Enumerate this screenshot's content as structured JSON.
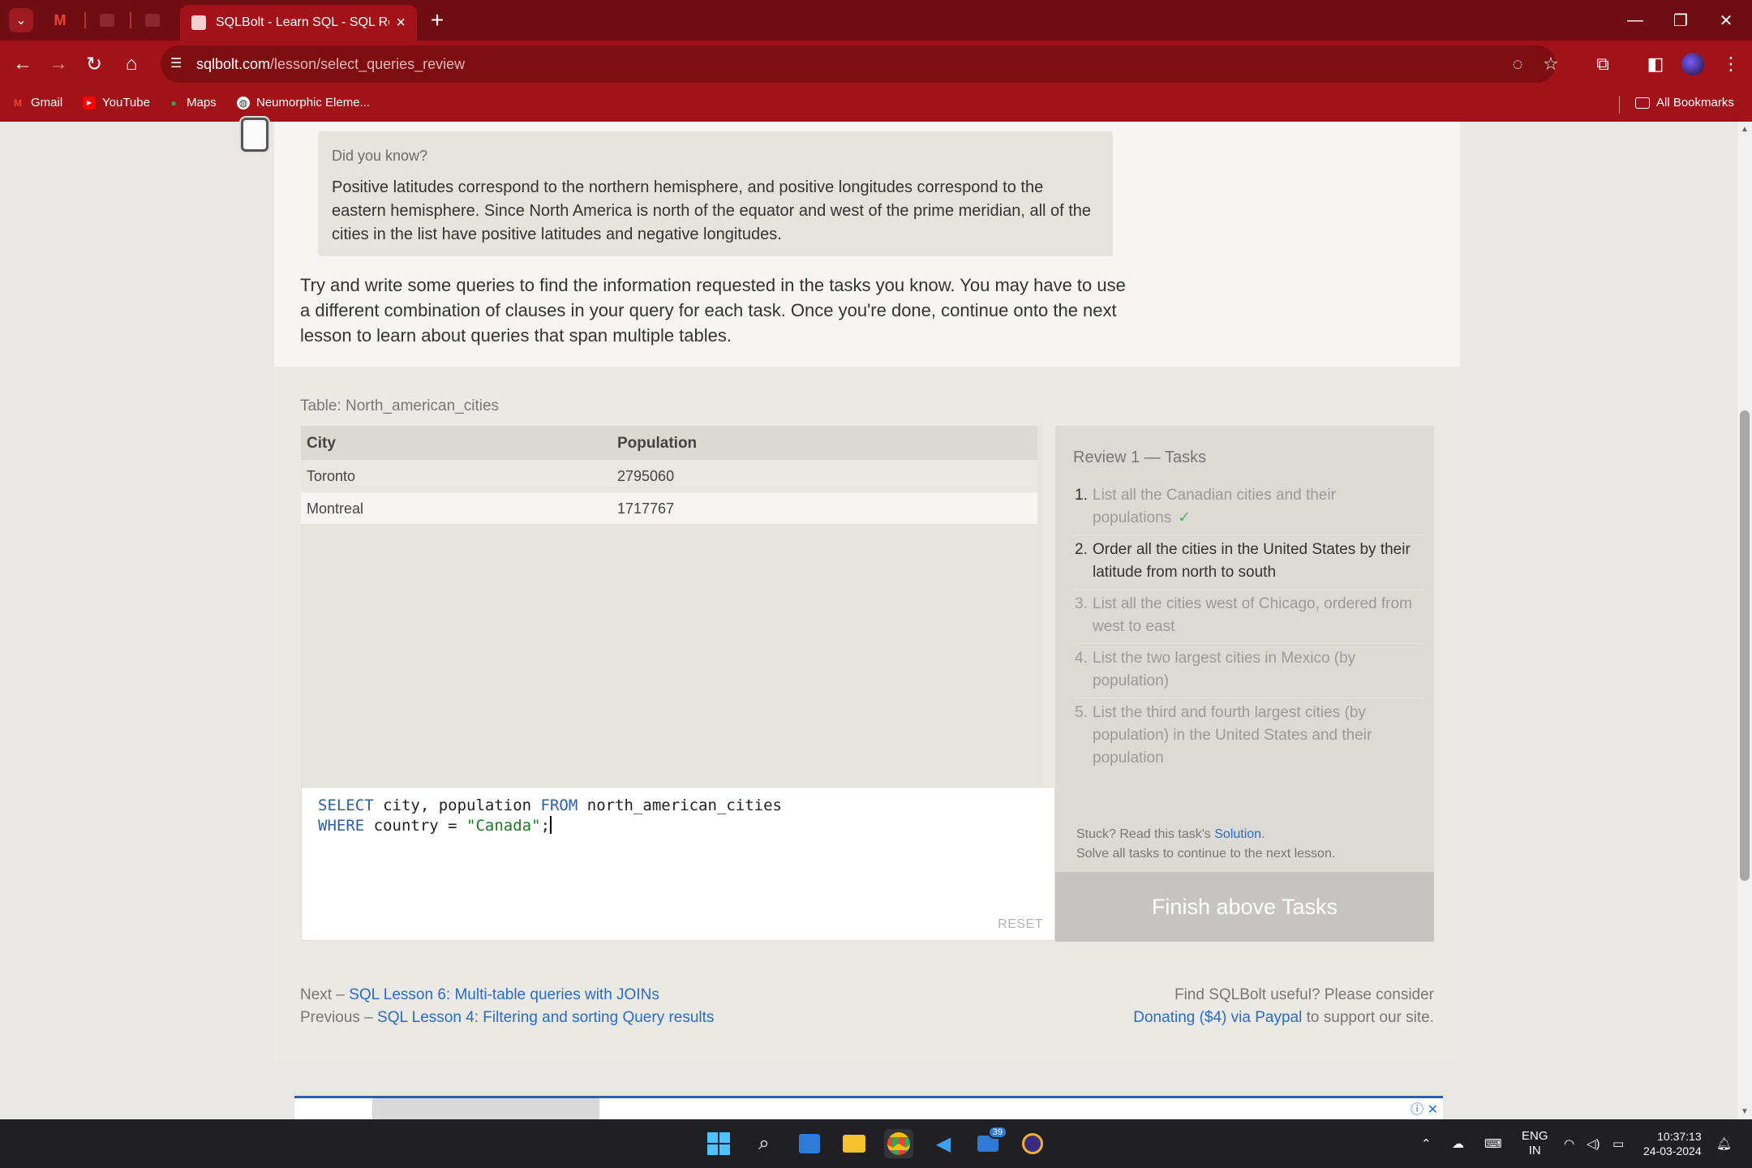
{
  "browser": {
    "active_tab_title": "SQLBolt - Learn SQL - SQL Revie",
    "url_host": "sqlbolt.com",
    "url_path": "/lesson/select_queries_review",
    "bookmarks": [
      {
        "label": "Gmail"
      },
      {
        "label": "YouTube"
      },
      {
        "label": "Maps"
      },
      {
        "label": "Neumorphic Eleme..."
      }
    ],
    "all_bookmarks": "All Bookmarks"
  },
  "lesson": {
    "did_you_know_heading": "Did you know?",
    "did_you_know_body": "Positive latitudes correspond to the northern hemisphere, and positive longitudes correspond to the eastern hemisphere. Since North America is north of the equator and west of the prime meridian, all of the cities in the list have positive latitudes and negative longitudes.",
    "intro": "Try and write some queries to find the information requested in the tasks you know. You may have to use a different combination of clauses in your query for each task. Once you're done, continue onto the next lesson to learn about queries that span multiple tables."
  },
  "table": {
    "label": "Table: North_american_cities",
    "columns": [
      "City",
      "Population"
    ],
    "rows": [
      [
        "Toronto",
        "2795060"
      ],
      [
        "Montreal",
        "1717767"
      ]
    ]
  },
  "editor": {
    "line1": {
      "kw1": "SELECT",
      "t1": " city, population ",
      "kw2": "FROM",
      "t2": " north_american_cities"
    },
    "line2": {
      "kw1": "WHERE",
      "t1": " country = ",
      "str": "\"Canada\"",
      "t2": ";"
    },
    "reset_label": "RESET"
  },
  "tasks": {
    "title": "Review 1 — Tasks",
    "items": [
      {
        "num": "1.",
        "text": "List all the Canadian cities and their populations",
        "done": "✓"
      },
      {
        "num": "2.",
        "text": "Order all the cities in the United States by their latitude from north to south"
      },
      {
        "num": "3.",
        "text": "List all the cities west of Chicago, ordered from west to east"
      },
      {
        "num": "4.",
        "text": "List the two largest cities in Mexico (by population)"
      },
      {
        "num": "5.",
        "text": "List the third and fourth largest cities (by population) in the United States and their population"
      }
    ],
    "stuck_prefix": "Stuck? Read this task's ",
    "solution_link": "Solution",
    "stuck_suffix": ".",
    "solve_all": "Solve all tasks to continue to the next lesson.",
    "finish_button": "Finish above Tasks"
  },
  "footer": {
    "next_prefix": "Next – ",
    "next_link": "SQL Lesson 6: Multi-table queries with JOINs",
    "prev_prefix": "Previous – ",
    "prev_link": "SQL Lesson 4: Filtering and sorting Query results",
    "useful": "Find SQLBolt useful? Please consider",
    "donate_link": "Donating ($4) via Paypal",
    "donate_suffix": " to support our site."
  },
  "taskbar": {
    "lang1": "ENG",
    "lang2": "IN",
    "time": "10:37:13",
    "date": "24-03-2024",
    "badge": "39"
  },
  "colors": {
    "chrome_dark": "#6e0e12",
    "chrome": "#a31218",
    "link": "#2a6cc7",
    "keyword": "#2b5fa8",
    "string": "#1d7a24",
    "check": "#55b35a"
  }
}
